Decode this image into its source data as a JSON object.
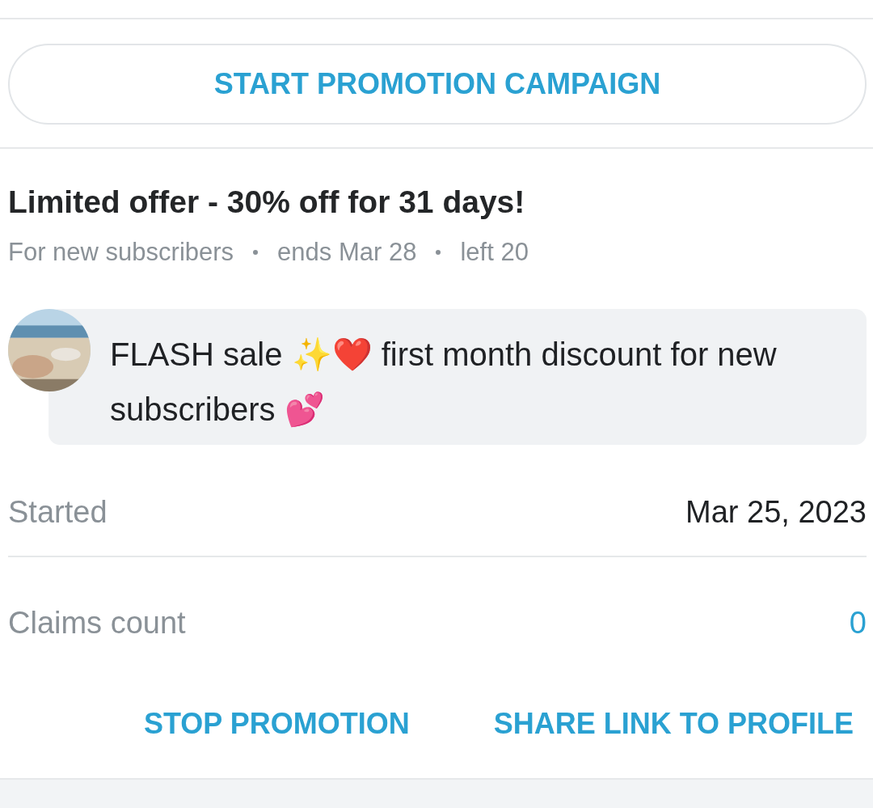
{
  "campaign_button": {
    "label": "START PROMOTION CAMPAIGN"
  },
  "offer": {
    "title": "Limited offer - 30% off for 31 days!",
    "meta": [
      "For new subscribers",
      "ends Mar 28",
      "left 20"
    ]
  },
  "message": {
    "text": "FLASH sale ✨❤️ first month discount for new subscribers 💕"
  },
  "details": [
    {
      "label": "Started",
      "value": "Mar 25, 2023",
      "kind": "plain"
    },
    {
      "label": "Claims count",
      "value": "0",
      "kind": "link"
    }
  ],
  "actions": [
    "STOP PROMOTION",
    "SHARE LINK TO PROFILE"
  ]
}
